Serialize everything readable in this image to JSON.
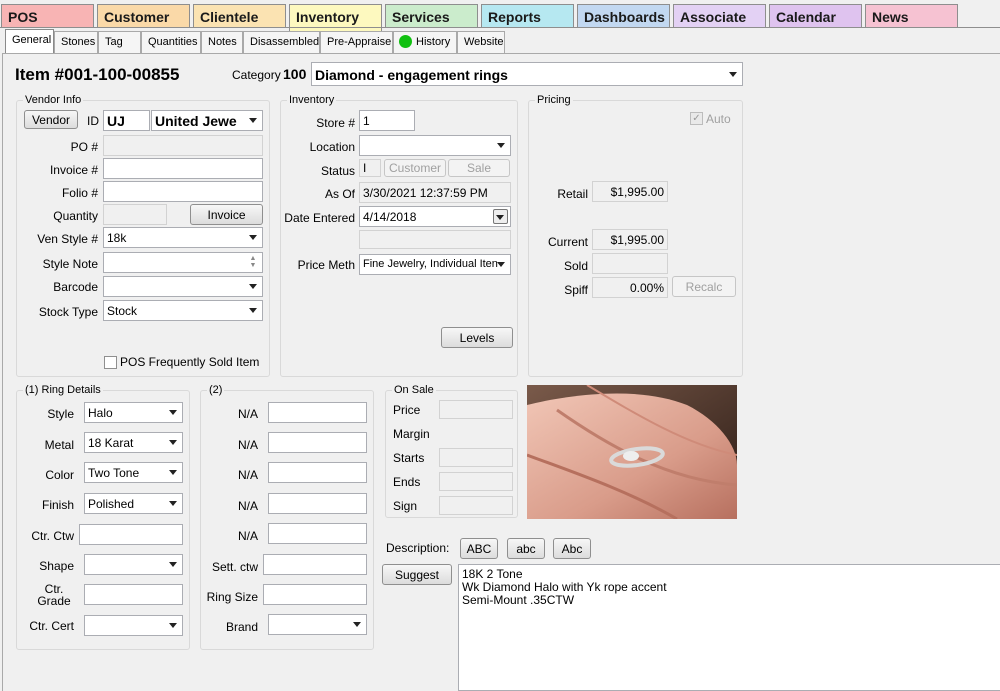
{
  "main_tabs": [
    {
      "label": "POS",
      "color": "#f8b4b4"
    },
    {
      "label": "Customer",
      "color": "#fad9a8"
    },
    {
      "label": "Clientele",
      "color": "#fbe3b2"
    },
    {
      "label": "Inventory",
      "color": "#fdf9bf"
    },
    {
      "label": "Services",
      "color": "#cbeccc"
    },
    {
      "label": "Reports",
      "color": "#b6e8f1"
    },
    {
      "label": "Dashboards",
      "color": "#c2d8f1"
    },
    {
      "label": "Associate",
      "color": "#e3d1f4"
    },
    {
      "label": "Calendar",
      "color": "#dfc3ef"
    },
    {
      "label": "News",
      "color": "#f6c2d2"
    }
  ],
  "sub_tabs": [
    "General",
    "Stones",
    "Tag",
    "Quantities",
    "Notes",
    "Disassembled",
    "Pre-Appraise",
    "History",
    "Website"
  ],
  "item": {
    "title": "Item #001-100-00855",
    "category_label": "Category",
    "category_code": "100",
    "category_value": "Diamond - engagement rings"
  },
  "vendor": {
    "group_title": "Vendor Info",
    "vendor_button": "Vendor",
    "id_label": "ID",
    "id_value": "UJ",
    "vendor_name": "United Jewe",
    "po_label": "PO #",
    "po_value": "",
    "invoice_label": "Invoice #",
    "invoice_value": "",
    "folio_label": "Folio #",
    "folio_value": "",
    "quantity_label": "Quantity",
    "quantity_value": "",
    "invoice_button": "Invoice",
    "ven_style_label": "Ven Style #",
    "ven_style_value": "18k",
    "style_note_label": "Style Note",
    "style_note_value": "",
    "barcode_label": "Barcode",
    "barcode_value": "",
    "stock_type_label": "Stock Type",
    "stock_type_value": "Stock",
    "pos_frequent_label": "POS Frequently Sold Item"
  },
  "inventory": {
    "group_title": "Inventory",
    "store_label": "Store #",
    "store_value": "1",
    "location_label": "Location",
    "location_value": "",
    "status_label": "Status",
    "status_value": "I",
    "customer_button": "Customer",
    "sale_button": "Sale",
    "as_of_label": "As Of",
    "as_of_value": "3/30/2021 12:37:59 PM",
    "date_entered_label": "Date Entered",
    "date_entered_value": "4/14/2018",
    "price_meth_label": "Price Meth",
    "price_meth_value": "Fine Jewelry, Individual Iten",
    "levels_button": "Levels"
  },
  "pricing": {
    "group_title": "Pricing",
    "auto_label": "Auto",
    "retail_label": "Retail",
    "retail_value": "$1,995.00",
    "current_label": "Current",
    "current_value": "$1,995.00",
    "sold_label": "Sold",
    "sold_value": "",
    "spiff_label": "Spiff",
    "spiff_value": "0.00%",
    "recalc_button": "Recalc"
  },
  "ring_details": {
    "group_title": "(1) Ring Details",
    "fields": [
      {
        "label": "Style",
        "value": "Halo",
        "type": "select"
      },
      {
        "label": "Metal",
        "value": "18 Karat",
        "type": "select"
      },
      {
        "label": "Color",
        "value": "Two Tone",
        "type": "select"
      },
      {
        "label": "Finish",
        "value": "Polished",
        "type": "select"
      },
      {
        "label": "Ctr. Ctw",
        "value": "",
        "type": "input"
      },
      {
        "label": "Shape",
        "value": "",
        "type": "select"
      },
      {
        "label": "Ctr. Grade",
        "value": "",
        "type": "input"
      },
      {
        "label": "Ctr. Cert",
        "value": "",
        "type": "select"
      }
    ]
  },
  "group2": {
    "group_title": "(2)",
    "fields": [
      {
        "label": "N/A",
        "value": "",
        "type": "input"
      },
      {
        "label": "N/A",
        "value": "",
        "type": "input"
      },
      {
        "label": "N/A",
        "value": "",
        "type": "input"
      },
      {
        "label": "N/A",
        "value": "",
        "type": "input"
      },
      {
        "label": "N/A",
        "value": "",
        "type": "input"
      },
      {
        "label": "Sett. ctw",
        "value": "",
        "type": "input"
      },
      {
        "label": "Ring Size",
        "value": "",
        "type": "input"
      },
      {
        "label": "Brand",
        "value": "",
        "type": "select"
      }
    ]
  },
  "on_sale": {
    "group_title": "On Sale",
    "price_label": "Price",
    "margin_label": "Margin",
    "starts_label": "Starts",
    "ends_label": "Ends",
    "sign_label": "Sign"
  },
  "description": {
    "label": "Description:",
    "upper_button": "ABC",
    "lower_button": "abc",
    "title_button": "Abc",
    "suggest_button": "Suggest",
    "lines": [
      "18K 2 Tone",
      "Wk Diamond Halo with Yk rope accent",
      "Semi-Mount .35CTW"
    ]
  }
}
